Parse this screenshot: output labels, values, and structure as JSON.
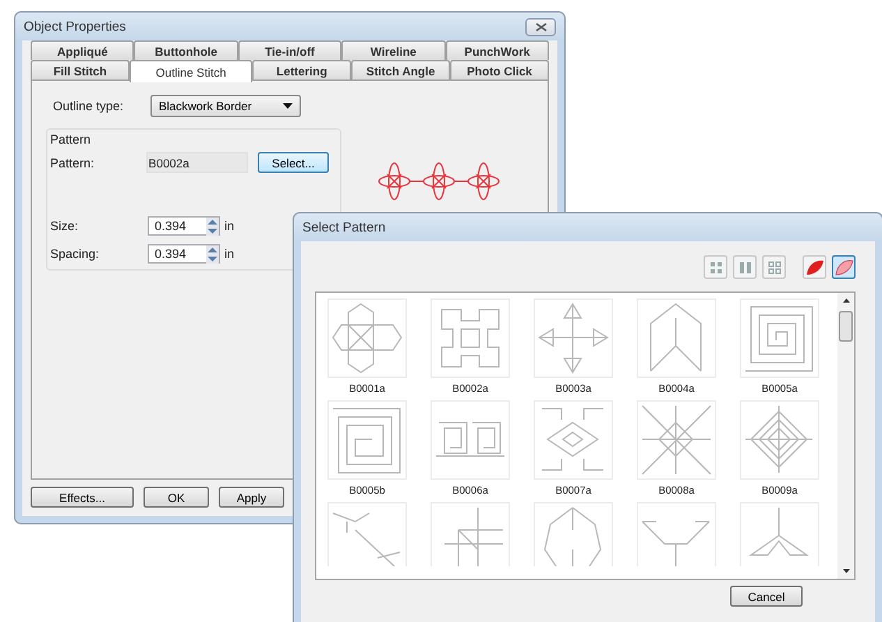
{
  "object_properties": {
    "title": "Object Properties",
    "tab_rows": [
      [
        {
          "label": "Appliqué",
          "selected": false
        },
        {
          "label": "Buttonhole",
          "selected": false
        },
        {
          "label": "Tie-in/off",
          "selected": false
        },
        {
          "label": "Wireline",
          "selected": false
        },
        {
          "label": "PunchWork",
          "selected": false
        }
      ],
      [
        {
          "label": "Fill Stitch",
          "selected": false
        },
        {
          "label": "Outline Stitch",
          "selected": true
        },
        {
          "label": "Lettering",
          "selected": false
        },
        {
          "label": "Stitch Angle",
          "selected": false
        },
        {
          "label": "Photo Click",
          "selected": false
        }
      ]
    ],
    "outline_type": {
      "label": "Outline type:",
      "value": "Blackwork Border"
    },
    "pattern_group": {
      "title": "Pattern",
      "pattern_label": "Pattern:",
      "pattern_value": "B0002a",
      "select_button": "Select...",
      "size": {
        "label": "Size:",
        "value": "0.394",
        "unit": "in"
      },
      "spacing": {
        "label": "Spacing:",
        "value": "0.394",
        "unit": "in"
      }
    },
    "buttons": [
      "Effects...",
      "OK",
      "Apply"
    ]
  },
  "select_pattern": {
    "title": "Select Pattern",
    "toolbar": [
      {
        "kind": "grid",
        "selected": false
      },
      {
        "kind": "columns",
        "selected": false
      },
      {
        "kind": "split",
        "selected": false
      },
      {
        "kind": "leaf-filled",
        "selected": false
      },
      {
        "kind": "leaf-light",
        "selected": true
      }
    ],
    "patterns": [
      {
        "label": "B0001a",
        "clipped": false
      },
      {
        "label": "B0002a",
        "clipped": false
      },
      {
        "label": "B0003a",
        "clipped": false
      },
      {
        "label": "B0004a",
        "clipped": false
      },
      {
        "label": "B0005a",
        "clipped": false
      },
      {
        "label": "B0005b",
        "clipped": false
      },
      {
        "label": "B0006a",
        "clipped": false
      },
      {
        "label": "B0007a",
        "clipped": false
      },
      {
        "label": "B0008a",
        "clipped": false
      },
      {
        "label": "B0009a",
        "clipped": false
      },
      {
        "clipped": true
      },
      {
        "clipped": true
      },
      {
        "clipped": true
      },
      {
        "clipped": true
      },
      {
        "clipped": true
      }
    ],
    "cancel_button": "Cancel"
  }
}
